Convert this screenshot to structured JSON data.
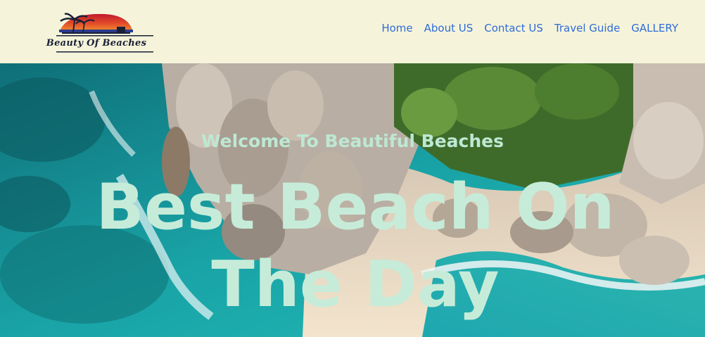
{
  "header": {
    "logo_text": "Beauty Of Beaches",
    "nav": [
      {
        "label": "Home"
      },
      {
        "label": "About US"
      },
      {
        "label": "Contact US"
      },
      {
        "label": "Travel Guide"
      },
      {
        "label": "GALLERY"
      }
    ]
  },
  "hero": {
    "welcome": "Welcome To Beautiful Beaches",
    "headline": "Best Beach On The Day"
  },
  "colors": {
    "header_bg": "#f5f4da",
    "nav_link": "#2f6bd8",
    "hero_text": "#c6ecd9",
    "sea": "#1aa5a8",
    "sand": "#f0e2cc"
  }
}
